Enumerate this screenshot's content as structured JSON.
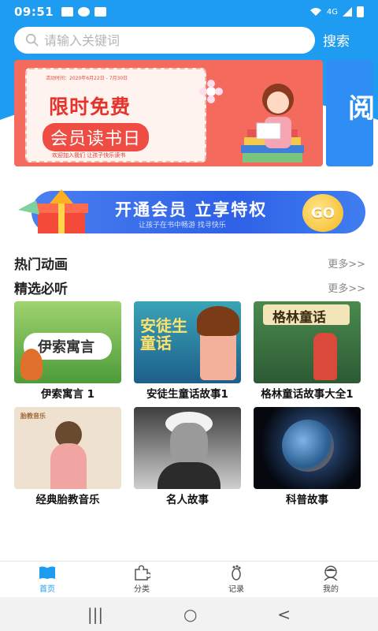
{
  "status_bar": {
    "time": "09:51",
    "network": "4G"
  },
  "search": {
    "placeholder": "请输入关键词",
    "button_label": "搜索"
  },
  "banner": {
    "date_text": "活动时间：2020年6月22日 - 7月30日",
    "title_line1": "限时免费",
    "title_line2": "会员读书日",
    "subtitle": "欢迎加入我们  让孩子快乐读书",
    "next_banner_char": "阅"
  },
  "vip_banner": {
    "title": "开通会员  立享特权",
    "subtitle": "让孩子在书中畅游  找寻快乐",
    "go_label": "GO"
  },
  "sections": [
    {
      "title": "热门动画",
      "more_label": "更多>>"
    },
    {
      "title": "精选必听",
      "more_label": "更多>>"
    }
  ],
  "cards": [
    {
      "label": "伊索寓言 1",
      "cover_text": "伊索寓言"
    },
    {
      "label": "安徒生童话故事1",
      "cover_text": "安徒生童话"
    },
    {
      "label": "格林童话故事大全1",
      "cover_text": "格林童话"
    },
    {
      "label": "经典胎教音乐",
      "cover_text": "胎教音乐"
    },
    {
      "label": "名人故事",
      "cover_text": ""
    },
    {
      "label": "科普故事",
      "cover_text": ""
    }
  ],
  "bottom_nav": [
    {
      "label": "首页",
      "icon": "book-icon",
      "active": true
    },
    {
      "label": "分类",
      "icon": "puzzle-icon",
      "active": false
    },
    {
      "label": "记录",
      "icon": "footprint-icon",
      "active": false
    },
    {
      "label": "我的",
      "icon": "user-icon",
      "active": false
    }
  ],
  "system_nav": {
    "recents": "|||",
    "home": "○",
    "back": "<"
  },
  "colors": {
    "primary": "#1e9cf1",
    "banner_red": "#f46b5e",
    "vip_blue": "#2e61e6"
  }
}
